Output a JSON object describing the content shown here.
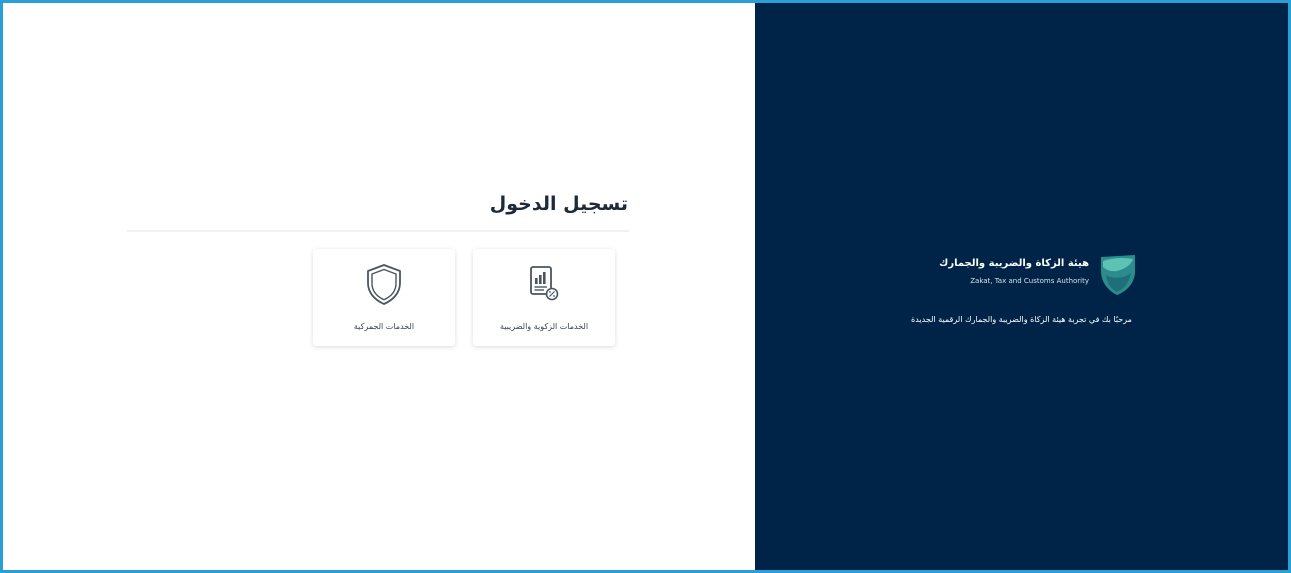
{
  "login": {
    "title": "تسجيل الدخول",
    "services": [
      {
        "label": "الخدمات الزكوية والضريبية",
        "icon": "tax-report-icon"
      },
      {
        "label": "الخدمات الجمركية",
        "icon": "shield-icon"
      }
    ]
  },
  "brand": {
    "name_ar": "هيئة الزكاة والضريبة والجمارك",
    "name_en": "Zakat, Tax and Customs Authority",
    "logo_icon": "zatca-logo-icon",
    "welcome": "مرحبًا بك في تجربة هيئة الزكاة والضريبة والجمارك الرقمية الجديدة"
  },
  "colors": {
    "panel_navy": "#002447",
    "frame_border": "#2a9fd6",
    "icon_stroke": "#4a5560",
    "logo_teal": "#3fa8a0"
  }
}
